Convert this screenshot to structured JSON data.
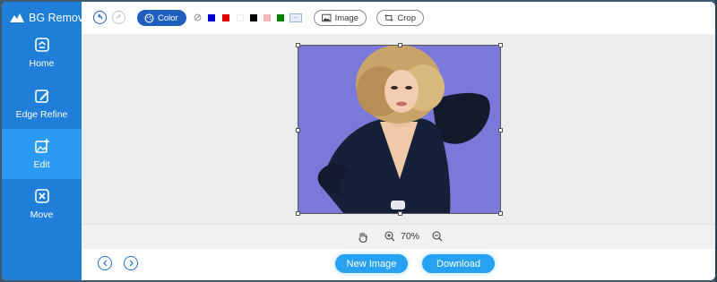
{
  "app": {
    "title": "BG Remover",
    "brand_color": "#1f7ed8",
    "active_color": "#2b9af3"
  },
  "sidebar": {
    "items": [
      {
        "label": "Home",
        "icon": "home-icon",
        "active": false
      },
      {
        "label": "Edge Refine",
        "icon": "edge-refine-icon",
        "active": false
      },
      {
        "label": "Edit",
        "icon": "edit-image-icon",
        "active": true
      },
      {
        "label": "Move",
        "icon": "move-icon",
        "active": false
      }
    ]
  },
  "toolbar": {
    "undo_icon": "undo-icon",
    "redo_icon": "redo-icon",
    "color_label": "Color",
    "no_color_icon": "no-color-icon",
    "swatches": [
      "#0000cc",
      "#e00000",
      "#ffffff",
      "#000000",
      "#f6b8c0",
      "#008000"
    ],
    "more_label": "...",
    "image_label": "Image",
    "crop_label": "Crop"
  },
  "canvas": {
    "background_color": "#7a79d9"
  },
  "zoom": {
    "hand_icon": "hand-icon",
    "zoom_in_icon": "zoom-in-icon",
    "zoom_out_icon": "zoom-out-icon",
    "level": "70%"
  },
  "bottom": {
    "prev_icon": "chevron-left-icon",
    "next_icon": "chevron-right-icon",
    "new_image_label": "New Image",
    "download_label": "Download"
  }
}
